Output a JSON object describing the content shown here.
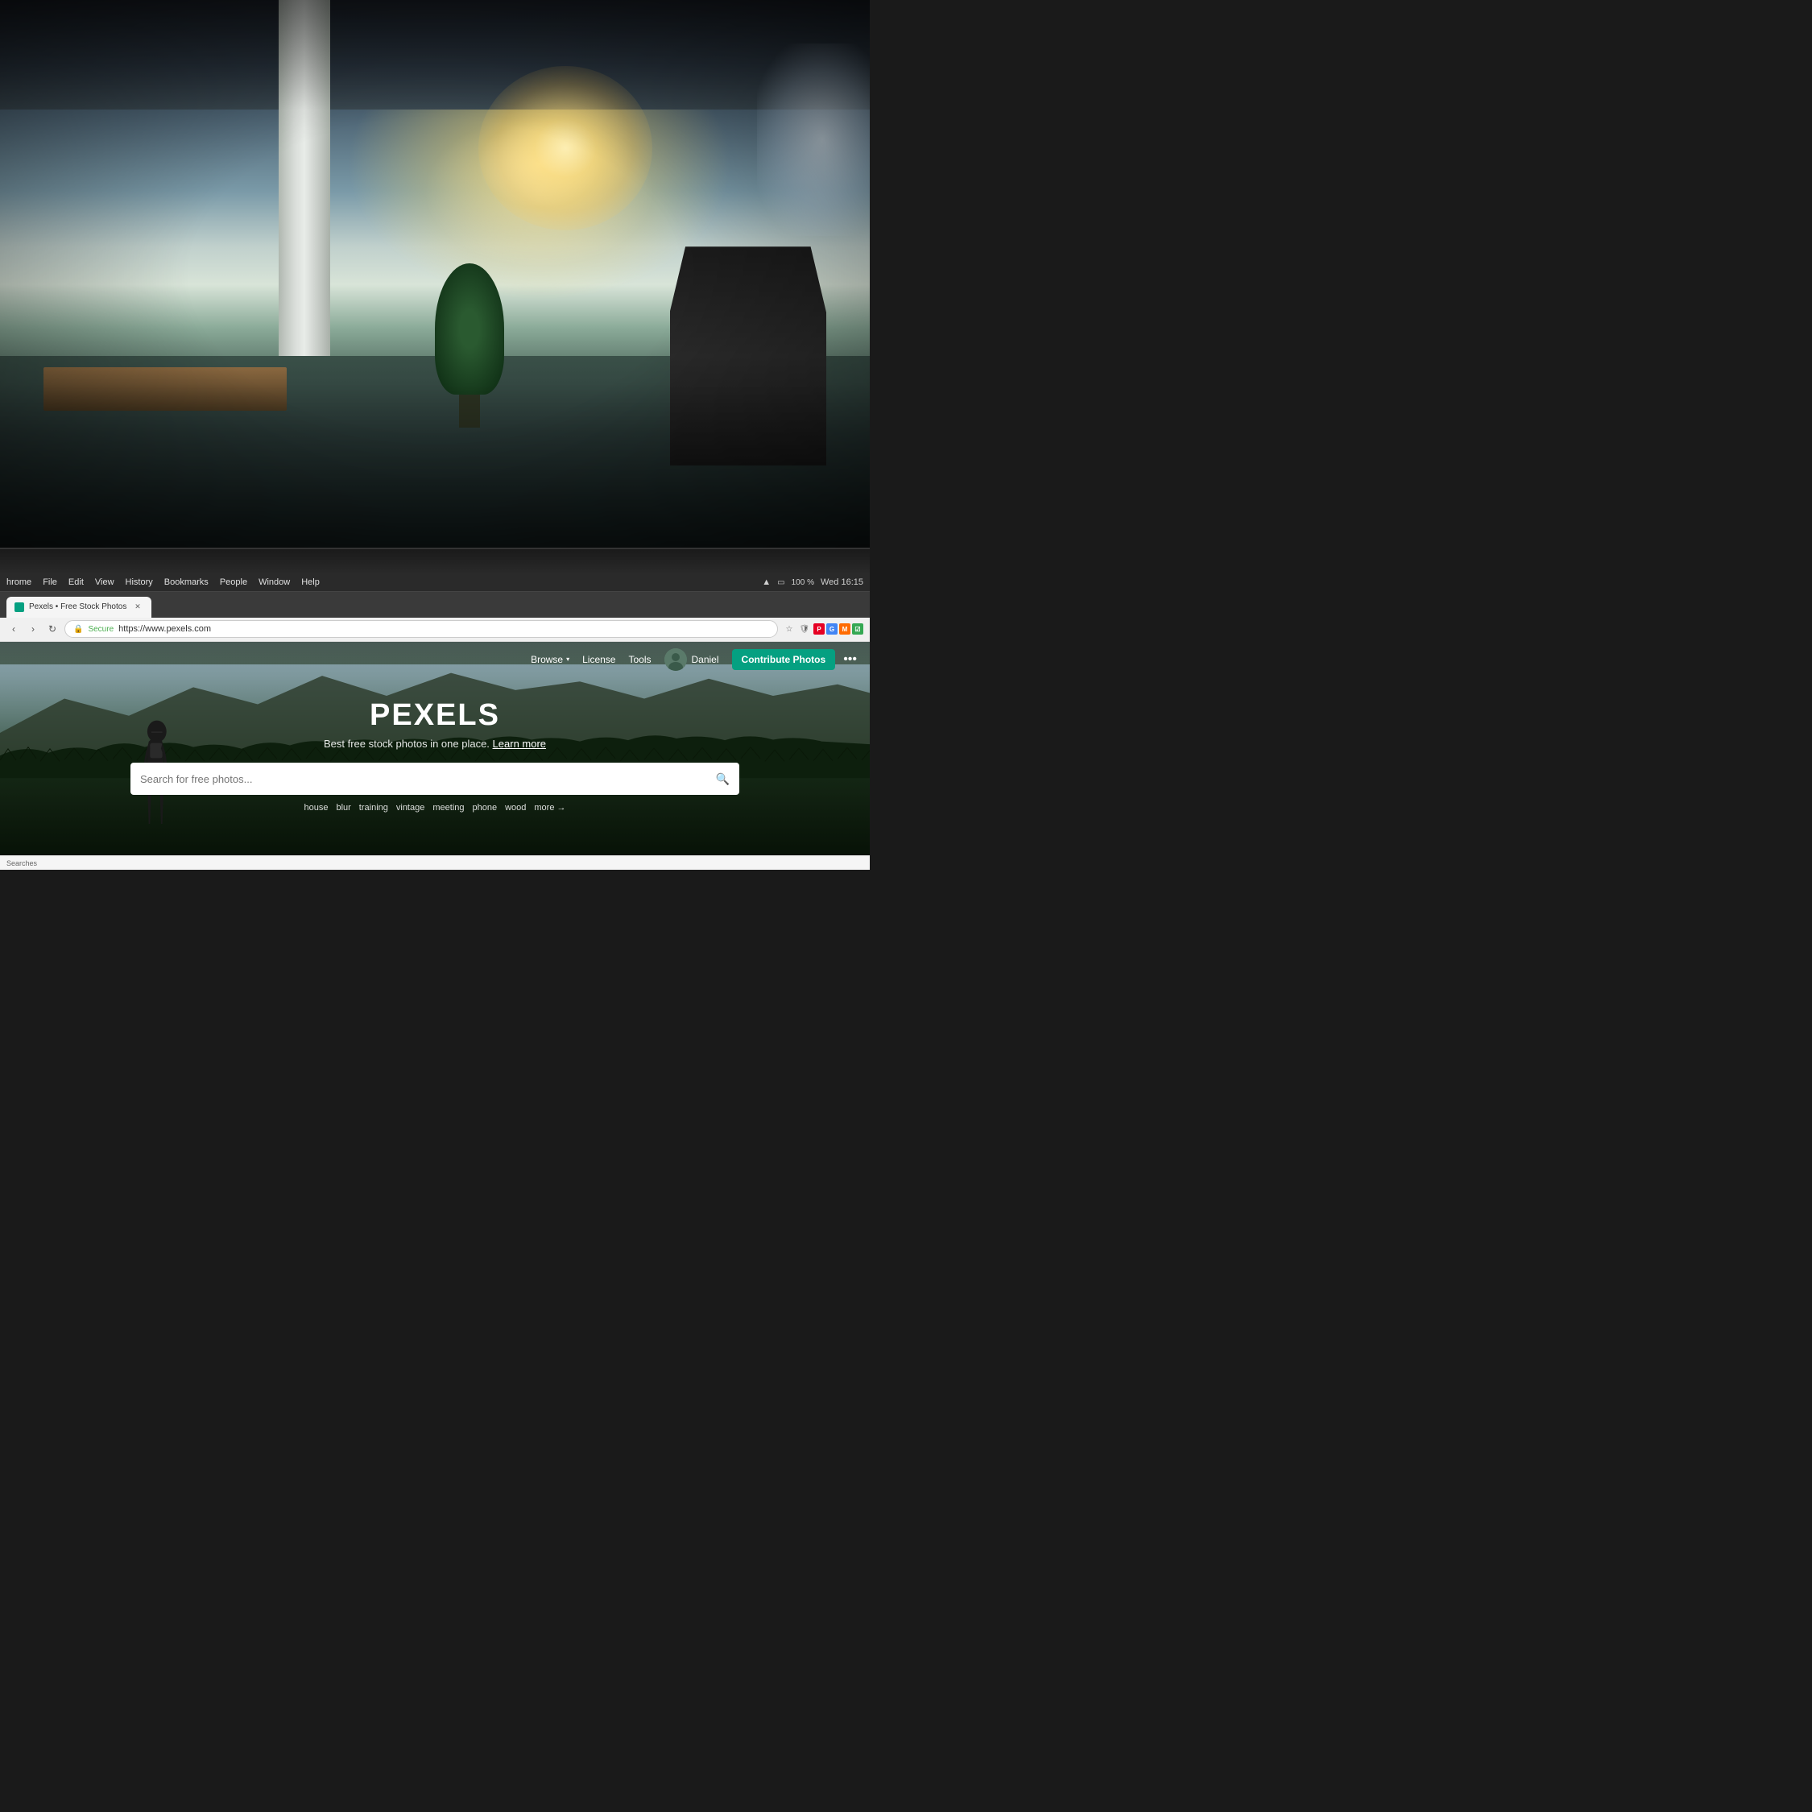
{
  "background": {
    "alt": "Office interior background photo"
  },
  "menubar": {
    "app_name": "hrome",
    "items": [
      "File",
      "Edit",
      "View",
      "History",
      "Bookmarks",
      "People",
      "Window",
      "Help"
    ],
    "right_items": [
      "Wed 16:15"
    ],
    "battery": "100 %"
  },
  "browser": {
    "tab": {
      "label": "Pexels • Free Stock Photos",
      "favicon_color": "#05a081"
    },
    "address": {
      "secure_label": "Secure",
      "url": "https://www.pexels.com",
      "protocol": "https://"
    }
  },
  "pexels": {
    "nav": {
      "browse_label": "Browse",
      "license_label": "License",
      "tools_label": "Tools",
      "username": "Daniel",
      "contribute_label": "Contribute Photos",
      "more_label": "•••"
    },
    "hero": {
      "logo": "PEXELS",
      "subtitle": "Best free stock photos in one place.",
      "learn_more": "Learn more",
      "search_placeholder": "Search for free photos...",
      "tags": [
        "house",
        "blur",
        "training",
        "vintage",
        "meeting",
        "phone",
        "wood"
      ],
      "more_tag": "more →"
    }
  },
  "statusbar": {
    "text": "Searches"
  }
}
